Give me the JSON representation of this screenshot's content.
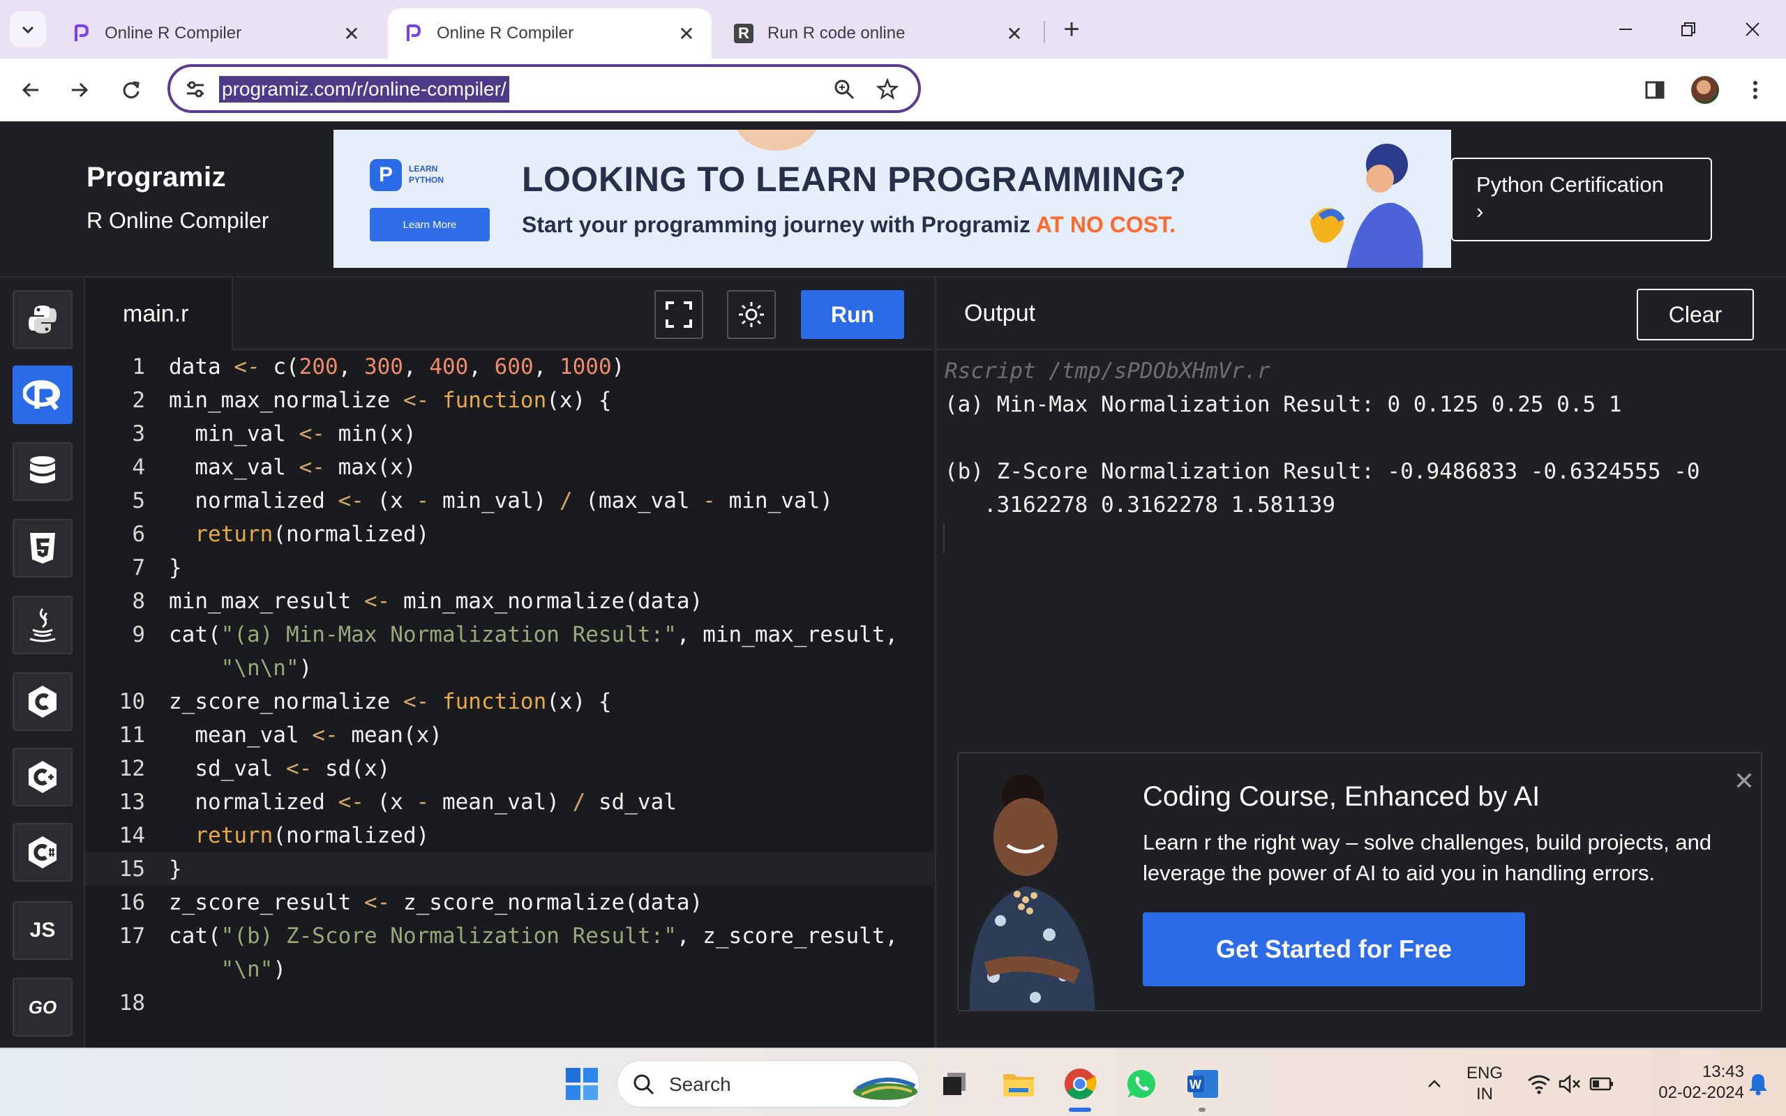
{
  "browser": {
    "tabs": [
      {
        "label": "Online R Compiler",
        "close": "✕",
        "active": false
      },
      {
        "label": "Online R Compiler",
        "close": "✕",
        "active": true
      },
      {
        "label": "Run R code online",
        "close": "✕",
        "active": false
      }
    ],
    "new_tab": "+",
    "url": "programiz.com/r/online-compiler/"
  },
  "header": {
    "logo": "Programiz",
    "subtitle": "R Online Compiler",
    "ad": {
      "logo_letter": "P",
      "badge_line1": "LEARN",
      "badge_line2": "PYTHON",
      "button": "Learn More",
      "headline": "LOOKING TO LEARN PROGRAMMING?",
      "subline_main": "Start your programming journey with Programiz ",
      "subline_highlight": "AT NO COST."
    },
    "cta": {
      "line1": "Python Certification",
      "line2": "›"
    }
  },
  "sidebar": {
    "items": [
      "python-icon",
      "r-icon",
      "sql-icon",
      "html5-icon",
      "java-icon",
      "c-icon",
      "cpp-icon",
      "csharp-icon",
      "js-icon",
      "go-icon"
    ],
    "js_label": "JS",
    "go_label": "GO"
  },
  "editor": {
    "filename": "main.r",
    "run_label": "Run",
    "lines": [
      {
        "n": "1",
        "code": [
          [
            "t",
            "data "
          ],
          [
            "o",
            "<- "
          ],
          [
            "t",
            "c("
          ],
          [
            "n",
            "200"
          ],
          [
            "t",
            ", "
          ],
          [
            "n",
            "300"
          ],
          [
            "t",
            ", "
          ],
          [
            "n",
            "400"
          ],
          [
            "t",
            ", "
          ],
          [
            "n",
            "600"
          ],
          [
            "t",
            ", "
          ],
          [
            "n",
            "1000"
          ],
          [
            "t",
            ")"
          ]
        ]
      },
      {
        "n": "2",
        "code": [
          [
            "t",
            "min_max_normalize "
          ],
          [
            "o",
            "<- "
          ],
          [
            "k",
            "function"
          ],
          [
            "t",
            "(x) {"
          ]
        ]
      },
      {
        "n": "3",
        "code": [
          [
            "t",
            "  min_val "
          ],
          [
            "o",
            "<- "
          ],
          [
            "t",
            "min(x)"
          ]
        ]
      },
      {
        "n": "4",
        "code": [
          [
            "t",
            "  max_val "
          ],
          [
            "o",
            "<- "
          ],
          [
            "t",
            "max(x)"
          ]
        ]
      },
      {
        "n": "5",
        "code": [
          [
            "t",
            "  normalized "
          ],
          [
            "o",
            "<- "
          ],
          [
            "t",
            "(x "
          ],
          [
            "o",
            "- "
          ],
          [
            "t",
            "min_val) "
          ],
          [
            "o",
            "/ "
          ],
          [
            "t",
            "(max_val "
          ],
          [
            "o",
            "- "
          ],
          [
            "t",
            "min_val)"
          ]
        ]
      },
      {
        "n": "6",
        "code": [
          [
            "k",
            "  return"
          ],
          [
            "t",
            "(normalized)"
          ]
        ]
      },
      {
        "n": "7",
        "code": [
          [
            "t",
            "}"
          ]
        ]
      },
      {
        "n": "8",
        "code": [
          [
            "t",
            "min_max_result "
          ],
          [
            "o",
            "<- "
          ],
          [
            "t",
            "min_max_normalize(data)"
          ]
        ]
      },
      {
        "n": "9",
        "code": [
          [
            "t",
            "cat("
          ],
          [
            "s",
            "\"(a) Min-Max Normalization Result:\""
          ],
          [
            "t",
            ", min_max_result,"
          ]
        ]
      },
      {
        "n": "",
        "code": [
          [
            "s",
            "    \"\\n\\n\""
          ],
          [
            "t",
            ")"
          ]
        ]
      },
      {
        "n": "10",
        "code": [
          [
            "t",
            "z_score_normalize "
          ],
          [
            "o",
            "<- "
          ],
          [
            "k",
            "function"
          ],
          [
            "t",
            "(x) {"
          ]
        ]
      },
      {
        "n": "11",
        "code": [
          [
            "t",
            "  mean_val "
          ],
          [
            "o",
            "<- "
          ],
          [
            "t",
            "mean(x)"
          ]
        ]
      },
      {
        "n": "12",
        "code": [
          [
            "t",
            "  sd_val "
          ],
          [
            "o",
            "<- "
          ],
          [
            "t",
            "sd(x)"
          ]
        ]
      },
      {
        "n": "13",
        "code": [
          [
            "t",
            "  normalized "
          ],
          [
            "o",
            "<- "
          ],
          [
            "t",
            "(x "
          ],
          [
            "o",
            "- "
          ],
          [
            "t",
            "mean_val) "
          ],
          [
            "o",
            "/ "
          ],
          [
            "t",
            "sd_val"
          ]
        ]
      },
      {
        "n": "14",
        "code": [
          [
            "k",
            "  return"
          ],
          [
            "t",
            "(normalized)"
          ]
        ]
      },
      {
        "n": "15",
        "code": [
          [
            "t",
            "}"
          ]
        ]
      },
      {
        "n": "16",
        "code": [
          [
            "t",
            "z_score_result "
          ],
          [
            "o",
            "<- "
          ],
          [
            "t",
            "z_score_normalize(data)"
          ]
        ]
      },
      {
        "n": "17",
        "code": [
          [
            "t",
            "cat("
          ],
          [
            "s",
            "\"(b) Z-Score Normalization Result:\""
          ],
          [
            "t",
            ", z_score_result,"
          ]
        ]
      },
      {
        "n": "",
        "code": [
          [
            "s",
            "    \"\\n\""
          ],
          [
            "t",
            ")"
          ]
        ]
      },
      {
        "n": "18",
        "code": []
      }
    ],
    "current_line_index": 15
  },
  "output": {
    "title": "Output",
    "clear_label": "Clear",
    "command": "Rscript /tmp/sPDObXHmVr.r",
    "lines": [
      "(a) Min-Max Normalization Result: 0 0.125 0.25 0.5 1",
      "",
      "(b) Z-Score Normalization Result: -0.9486833 -0.6324555 -0",
      "   .3162278 0.3162278 1.581139"
    ]
  },
  "promo": {
    "title": "Coding Course, Enhanced by AI",
    "description": "Learn r the right way – solve challenges, build projects, and leverage the power of AI to aid you in handling errors.",
    "button": "Get Started for Free",
    "close": "✕"
  },
  "taskbar": {
    "search_label": "Search",
    "lang_line1": "ENG",
    "lang_line2": "IN",
    "time": "13:43",
    "date": "02-02-2024"
  },
  "colors": {
    "accent": "#2c6be8",
    "background": "#1f2024",
    "keyword": "#e7a94a",
    "number": "#ef8a6a",
    "string": "#9aa87a"
  }
}
